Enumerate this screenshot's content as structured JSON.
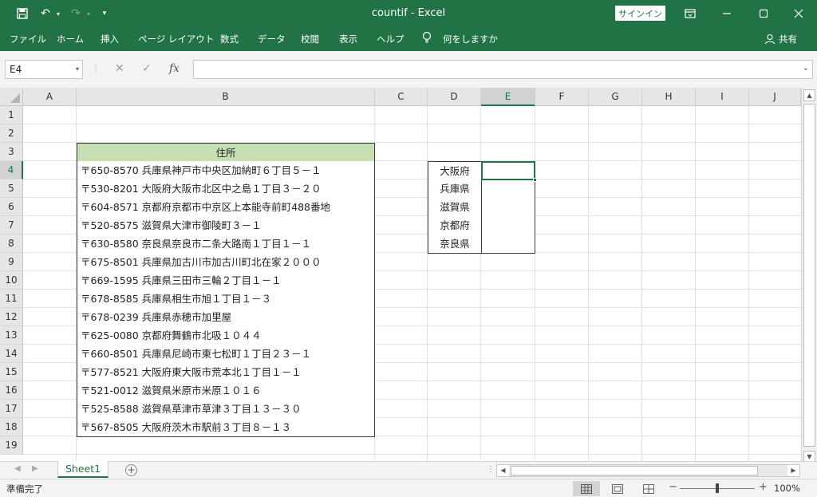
{
  "window": {
    "title": "countif  -  Excel",
    "signin_label": "サインイン",
    "accent": "#217346"
  },
  "ribbon": {
    "tabs": [
      "ファイル",
      "ホーム",
      "挿入",
      "ページ レイアウト",
      "数式",
      "データ",
      "校閲",
      "表示",
      "ヘルプ"
    ],
    "tell_me": "何をしますか",
    "share": "共有"
  },
  "formula_bar": {
    "name_box": "E4",
    "formula": ""
  },
  "grid": {
    "columns": [
      "A",
      "B",
      "C",
      "D",
      "E",
      "F",
      "G",
      "H",
      "I",
      "J"
    ],
    "selected_column": "E",
    "rows": [
      "1",
      "2",
      "3",
      "4",
      "5",
      "6",
      "7",
      "8",
      "9",
      "10",
      "11",
      "12",
      "13",
      "14",
      "15",
      "16",
      "17",
      "18",
      "19"
    ],
    "selected_row": "4",
    "address_header": "住所",
    "addresses": [
      "〒650-8570 兵庫県神戸市中央区加納町６丁目５－１",
      "〒530-8201 大阪府大阪市北区中之島１丁目３－２０",
      "〒604-8571 京都府京都市中京区上本能寺前町488番地",
      "〒520-8575 滋賀県大津市御陵町３－１",
      "〒630-8580 奈良県奈良市二条大路南１丁目１－１",
      "〒675-8501 兵庫県加古川市加古川町北在家２０００",
      "〒669-1595 兵庫県三田市三輪２丁目１－１",
      "〒678-8585 兵庫県相生市旭１丁目１－３",
      "〒678-0239 兵庫県赤穂市加里屋",
      "〒625-0080 京都府舞鶴市北吸１０４４",
      "〒660-8501 兵庫県尼崎市東七松町１丁目２３－１",
      "〒577-8521 大阪府東大阪市荒本北１丁目１－１",
      "〒521-0012 滋賀県米原市米原１０１６",
      "〒525-8588 滋賀県草津市草津３丁目１３－３０",
      "〒567-8505 大阪府茨木市駅前３丁目８－１３"
    ],
    "prefectures": [
      "大阪府",
      "兵庫県",
      "滋賀県",
      "京都府",
      "奈良県"
    ],
    "header_fill": "#c6e0b4"
  },
  "sheets": {
    "tabs": [
      "Sheet1"
    ],
    "active": "Sheet1"
  },
  "status": {
    "text": "準備完了",
    "zoom": "100%"
  }
}
